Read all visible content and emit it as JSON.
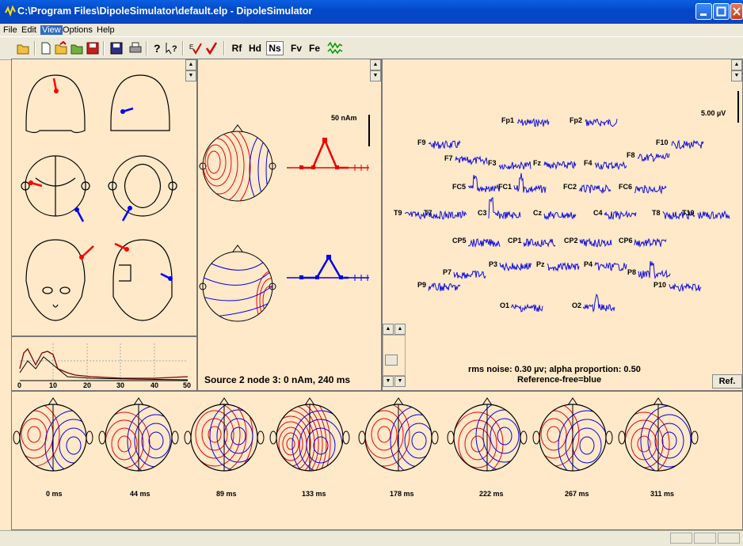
{
  "window": {
    "title": "C:\\Program Files\\DipoleSimulator\\default.elp - DipoleSimulator"
  },
  "menu": {
    "items": [
      "File",
      "Edit",
      "View",
      "Options",
      "Help"
    ],
    "active": "View"
  },
  "toolbar": {
    "text_buttons": [
      "Rf",
      "Hd",
      "Ns",
      "Fv",
      "Fe"
    ],
    "selected": "Ns"
  },
  "spectrum": {
    "ticks": [
      "0",
      "10",
      "20",
      "30",
      "40",
      "50"
    ]
  },
  "source_panel": {
    "scale_label": "50 nAm",
    "status": "Source 2 node 3: 0 nAm, 240 ms"
  },
  "eeg_panel": {
    "scale_label": "5.00 µV",
    "channels": [
      "Fp1",
      "Fp2",
      "F9",
      "F7",
      "F3",
      "Fz",
      "F4",
      "F8",
      "F10",
      "FC5",
      "FC1",
      "FC2",
      "FC6",
      "T9",
      "T7",
      "C3",
      "Cz",
      "C4",
      "T8",
      "T10",
      "CP5",
      "CP1",
      "CP2",
      "CP6",
      "P7",
      "P3",
      "Pz",
      "P4",
      "P8",
      "P9",
      "P10",
      "O1",
      "O2"
    ],
    "noise_line": "rms noise: 0.30 µv; alpha proportion: 0.50",
    "reference_line": "Reference-free=blue",
    "ref_button": "Ref."
  },
  "maps": {
    "times": [
      "0 ms",
      "44 ms",
      "89 ms",
      "133 ms",
      "178 ms",
      "222 ms",
      "267 ms",
      "311 ms"
    ]
  },
  "colors": {
    "title_bar": "#0a58e0",
    "panel_bg": "#ffe9c9",
    "source1": "#ff0000",
    "source2": "#0000ff"
  }
}
